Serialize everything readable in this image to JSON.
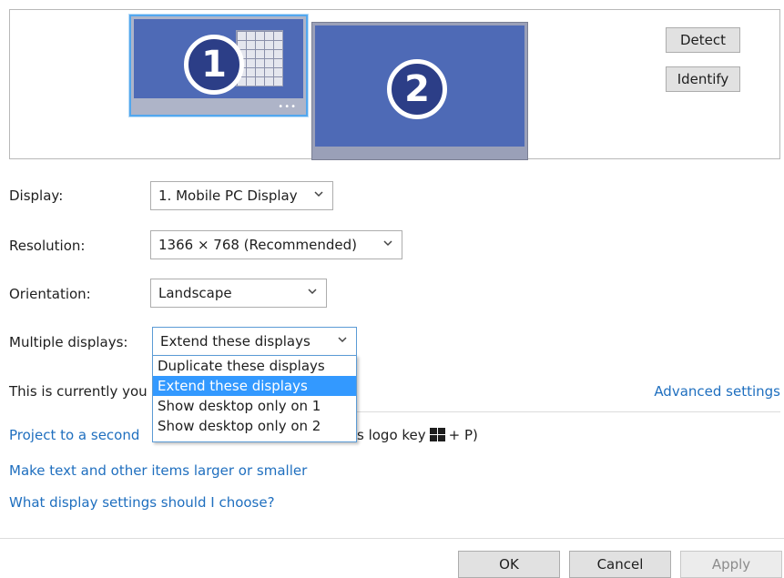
{
  "arrangement": {
    "monitor1_number": "1",
    "monitor2_number": "2",
    "taskbar_dots": "•••",
    "detect_label": "Detect",
    "identify_label": "Identify"
  },
  "settings": {
    "display_label": "Display:",
    "display_value": "1. Mobile PC Display",
    "resolution_label": "Resolution:",
    "resolution_value": "1366 × 768 (Recommended)",
    "orientation_label": "Orientation:",
    "orientation_value": "Landscape",
    "multiple_label": "Multiple displays:",
    "multiple_value": "Extend these displays"
  },
  "dropdown": {
    "options": [
      "Duplicate these displays",
      "Extend these displays",
      "Show desktop only on 1",
      "Show desktop only on 2"
    ],
    "selected_index": 1
  },
  "status": {
    "current_text_visible": "This is currently you",
    "advanced_link": "Advanced settings"
  },
  "links": {
    "project_prefix": "Project to a second",
    "project_suffix_a": "s logo key",
    "project_suffix_b": "+ P)",
    "larger_text": "Make text and other items larger or smaller",
    "what_settings": "What display settings should I choose?"
  },
  "footer": {
    "ok_label": "OK",
    "cancel_label": "Cancel",
    "apply_label": "Apply"
  },
  "colors": {
    "accent": "#3399ff",
    "link": "#1f6fbf",
    "screen": "#4e6ab6",
    "badge": "#2c3e87",
    "selected_monitor_border": "#52a7ee"
  },
  "icons": {
    "chevron": "chevron-down-icon",
    "windows_logo": "windows-logo-icon"
  }
}
